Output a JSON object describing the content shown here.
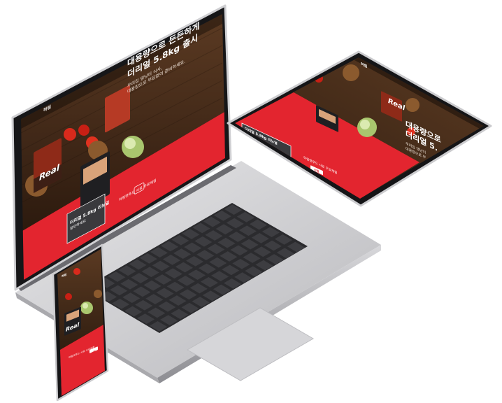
{
  "laptop": {
    "logo": "하림",
    "headline_line1": "대용량으로 든든하게",
    "headline_line2": "더리얼 5.8kg 출시",
    "sub_line1": "우리집 댕냥이 식사,",
    "sub_line2": "대용량으로 부담없이 준비하세요.",
    "pack_brand": "Real",
    "banner_text": "하림펫푸드 사료 무료체험",
    "box_text1": "더리얼 5.8kg 리뉴얼",
    "box_text2": "할인하세요"
  },
  "tablet": {
    "logo": "하림",
    "headline_line1": "대용량으로",
    "headline_line2": "더리얼 5.",
    "sub_line1": "우리집 댕냥이",
    "sub_line2": "대용량으로 부",
    "pack_brand": "Real",
    "box_text": "더리얼 5.8kg 리뉴얼",
    "banner_text": "하림펫푸드 사료 무료체험",
    "button_label": "신청"
  },
  "phone": {
    "logo": "하림",
    "pack_brand": "Real",
    "banner_text": "하림펫푸드 사료 무료체험",
    "button_label": "신청"
  },
  "colors": {
    "brand_red": "#e3252f",
    "wood_dark": "#3d2616",
    "device_silver": "#c9c9cc"
  }
}
